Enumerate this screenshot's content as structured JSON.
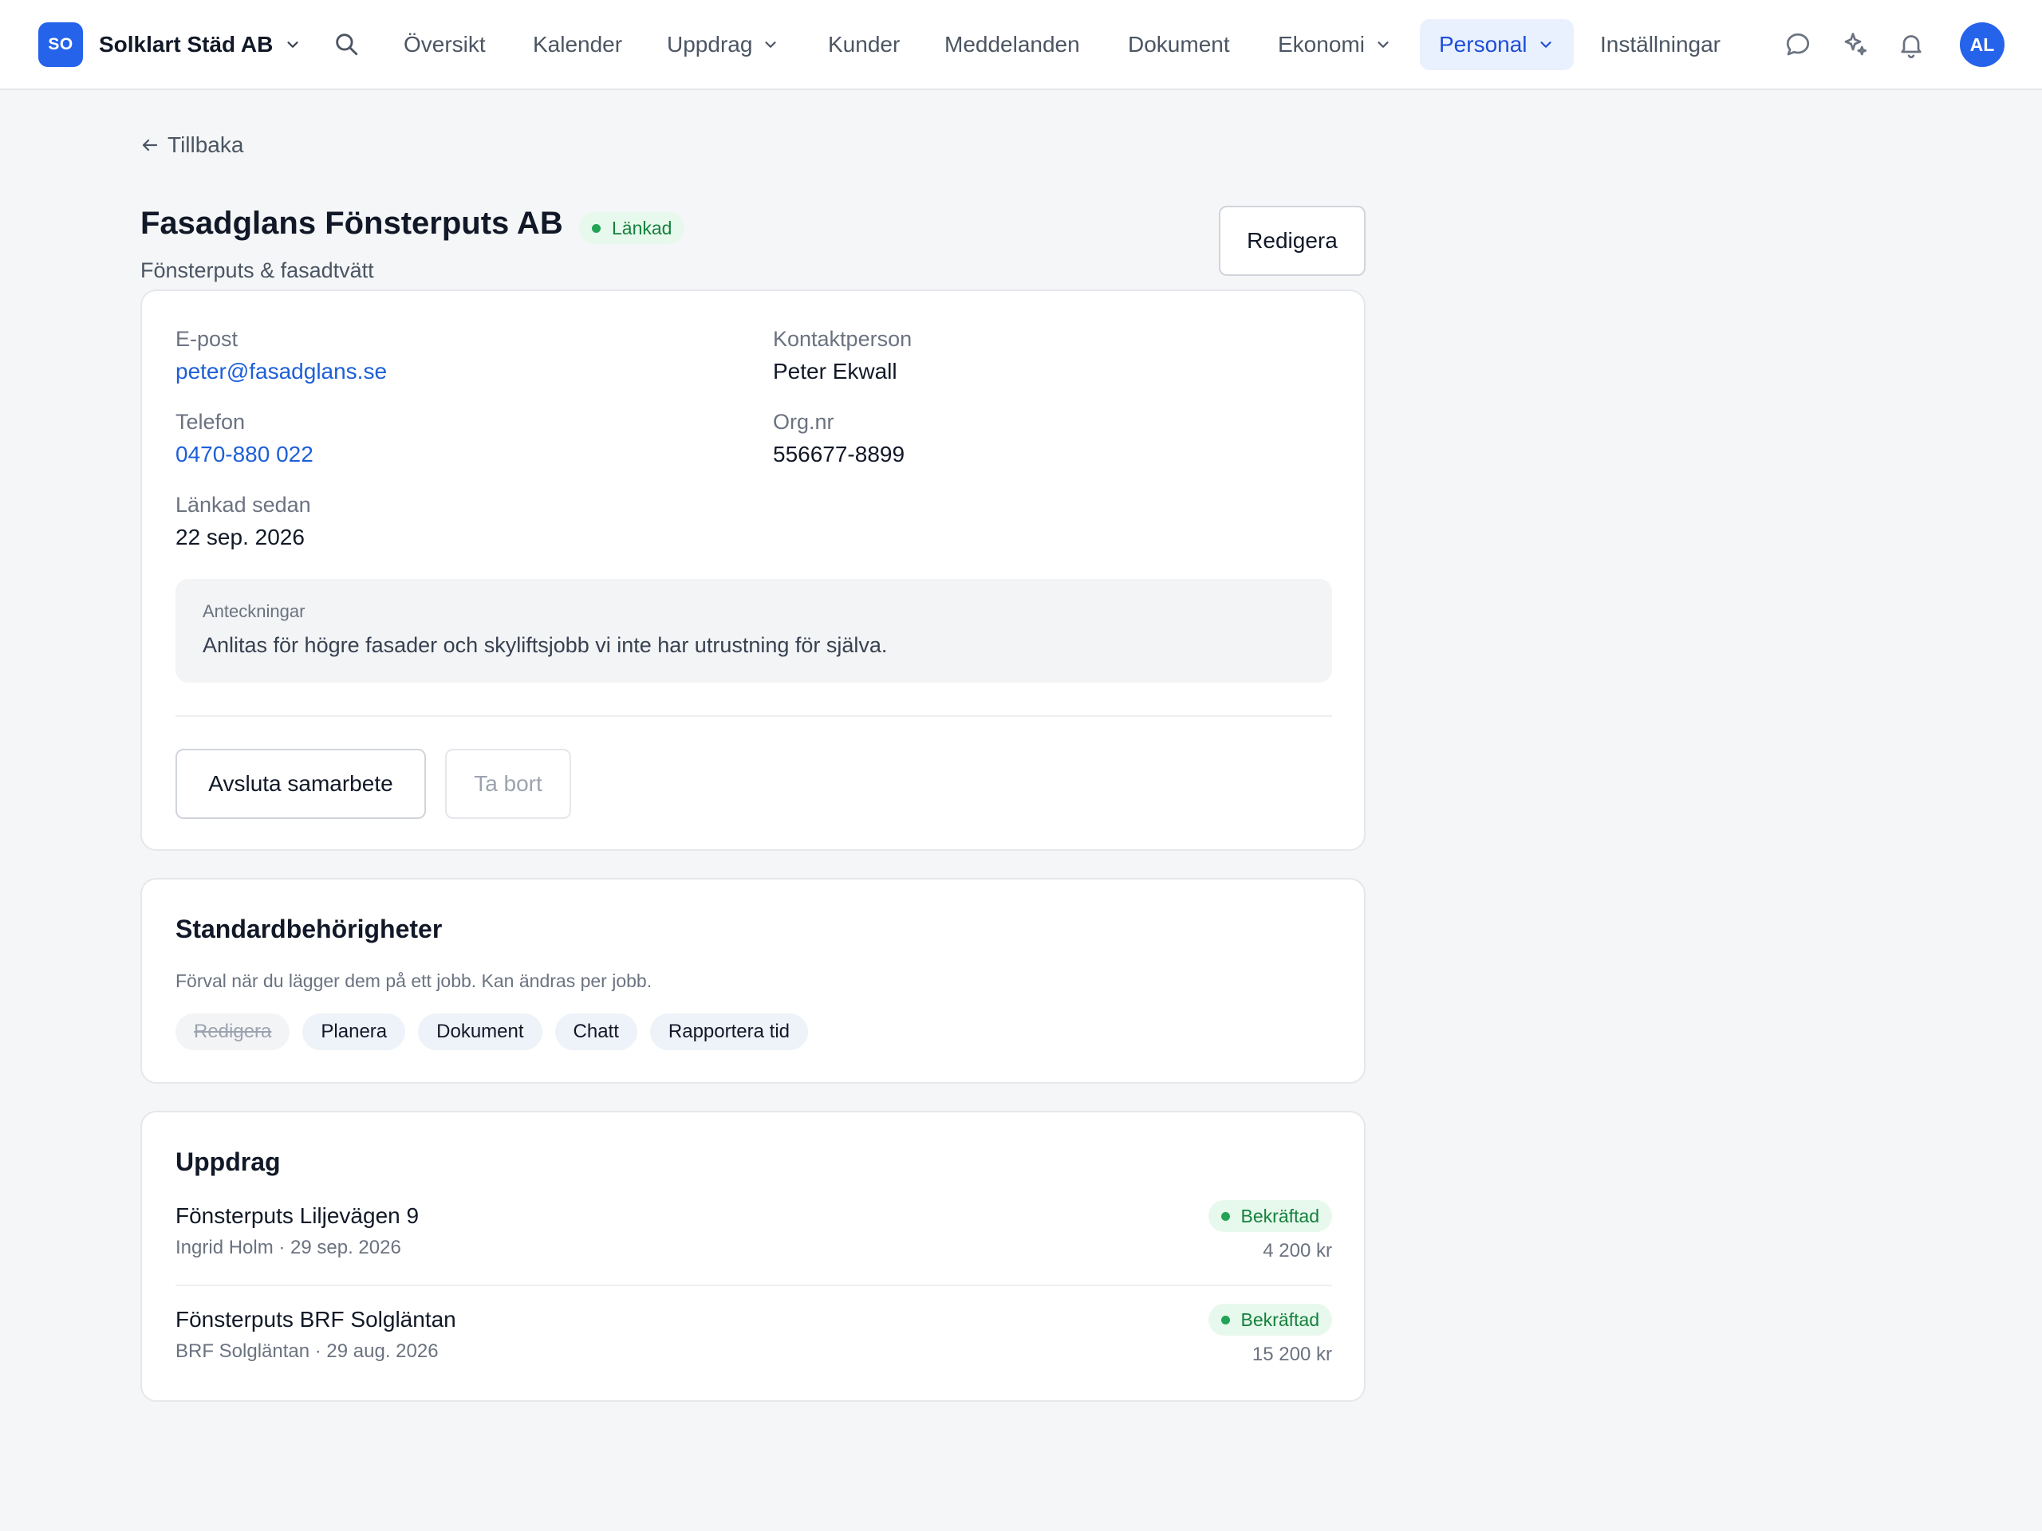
{
  "nav": {
    "org_initials": "SO",
    "org_name": "Solklart Städ AB",
    "items": [
      {
        "label": "Översikt"
      },
      {
        "label": "Kalender"
      },
      {
        "label": "Uppdrag"
      },
      {
        "label": "Kunder"
      },
      {
        "label": "Meddelanden"
      },
      {
        "label": "Dokument"
      },
      {
        "label": "Ekonomi"
      },
      {
        "label": "Personal"
      },
      {
        "label": "Inställningar"
      }
    ],
    "active_item": "Personal",
    "user_initials": "AL",
    "icons": [
      "search-icon",
      "chat-icon",
      "sparkle-icon",
      "bell-icon"
    ]
  },
  "back_label": "Tillbaka",
  "partner": {
    "name": "Fasadglans Fönsterputs AB",
    "status": "Länkad",
    "category": "Fönsterputs & fasadtvätt",
    "edit_label": "Redigera"
  },
  "details": {
    "email_label": "E-post",
    "email": "peter@fasadglans.se",
    "contact_label": "Kontaktperson",
    "contact": "Peter Ekwall",
    "phone_label": "Telefon",
    "phone": "0470-880 022",
    "org_label": "Org.nr",
    "org_nr": "556677-8899",
    "linked_label": "Länkad sedan",
    "linked_since": "22 sep. 2026",
    "notes_label": "Anteckningar",
    "notes": "Anlitas för högre fasader och skyliftsjobb vi inte har utrustning för själva.",
    "end_label": "Avsluta samarbete",
    "delete_label": "Ta bort"
  },
  "permissions": {
    "title": "Standardbehörigheter",
    "description": "Förval när du lägger dem på ett jobb. Kan ändras per jobb.",
    "chips": [
      {
        "label": "Redigera",
        "enabled": false
      },
      {
        "label": "Planera",
        "enabled": true
      },
      {
        "label": "Dokument",
        "enabled": true
      },
      {
        "label": "Chatt",
        "enabled": true
      },
      {
        "label": "Rapportera tid",
        "enabled": true
      }
    ]
  },
  "jobs": {
    "title": "Uppdrag",
    "items": [
      {
        "name": "Fönsterputs Liljevägen 9",
        "meta": "Ingrid Holm · 29 sep. 2026",
        "status": "Bekräftad",
        "price": "4 200 kr"
      },
      {
        "name": "Fönsterputs BRF Solgläntan",
        "meta": "BRF Solgläntan · 29 aug. 2026",
        "status": "Bekräftad",
        "price": "15 200 kr"
      }
    ]
  },
  "colors": {
    "accent": "#2563eb",
    "link": "#1d5fd8",
    "success_bg": "#e7f8ec",
    "success_text": "#15803d",
    "page_bg": "#f5f6f7"
  }
}
